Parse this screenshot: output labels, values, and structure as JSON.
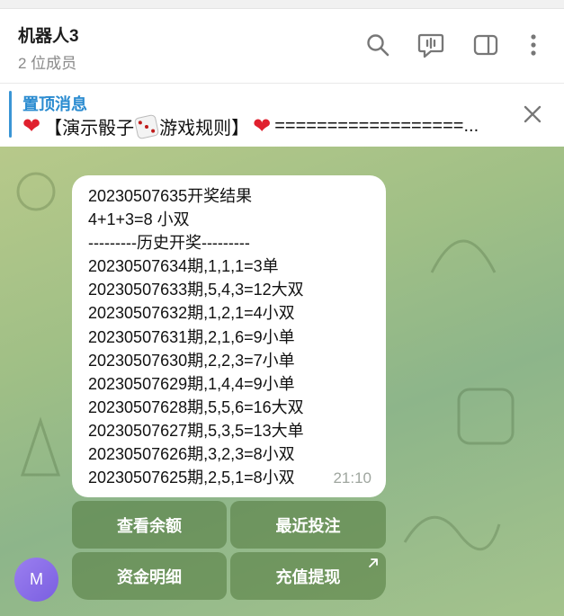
{
  "header": {
    "title": "机器人3",
    "subtitle": "2 位成员"
  },
  "pinned": {
    "title": "置顶消息",
    "text_a": "【演示骰子",
    "text_b": "游戏规则】",
    "text_c": " ==================..."
  },
  "message": {
    "lines": [
      "20230507635开奖结果",
      "4+1+3=8 小双",
      "---------历史开奖---------",
      "20230507634期,1,1,1=3单",
      "20230507633期,5,4,3=12大双",
      "20230507632期,1,2,1=4小双",
      "20230507631期,2,1,6=9小单",
      "20230507630期,2,2,3=7小单",
      "20230507629期,1,4,4=9小单",
      "20230507628期,5,5,6=16大双",
      "20230507627期,5,3,5=13大单",
      "20230507626期,3,2,3=8小双",
      "20230507625期,2,5,1=8小双"
    ],
    "time": "21:10"
  },
  "keyboard": {
    "btn1": "查看余额",
    "btn2": "最近投注",
    "btn3": "资金明细",
    "btn4": "充值提现"
  },
  "avatar": {
    "letter": "M",
    "color": "#8a6ee8"
  },
  "colors": {
    "accent": "#2a8bd0",
    "bubble": "#ffffff",
    "chat_bg": "#9fbf86"
  },
  "icons": [
    "search-icon",
    "voice-chat-icon",
    "sidebar-toggle-icon",
    "more-vertical-icon",
    "close-icon",
    "red-heart-icon",
    "dice-icon",
    "external-arrow-icon"
  ]
}
